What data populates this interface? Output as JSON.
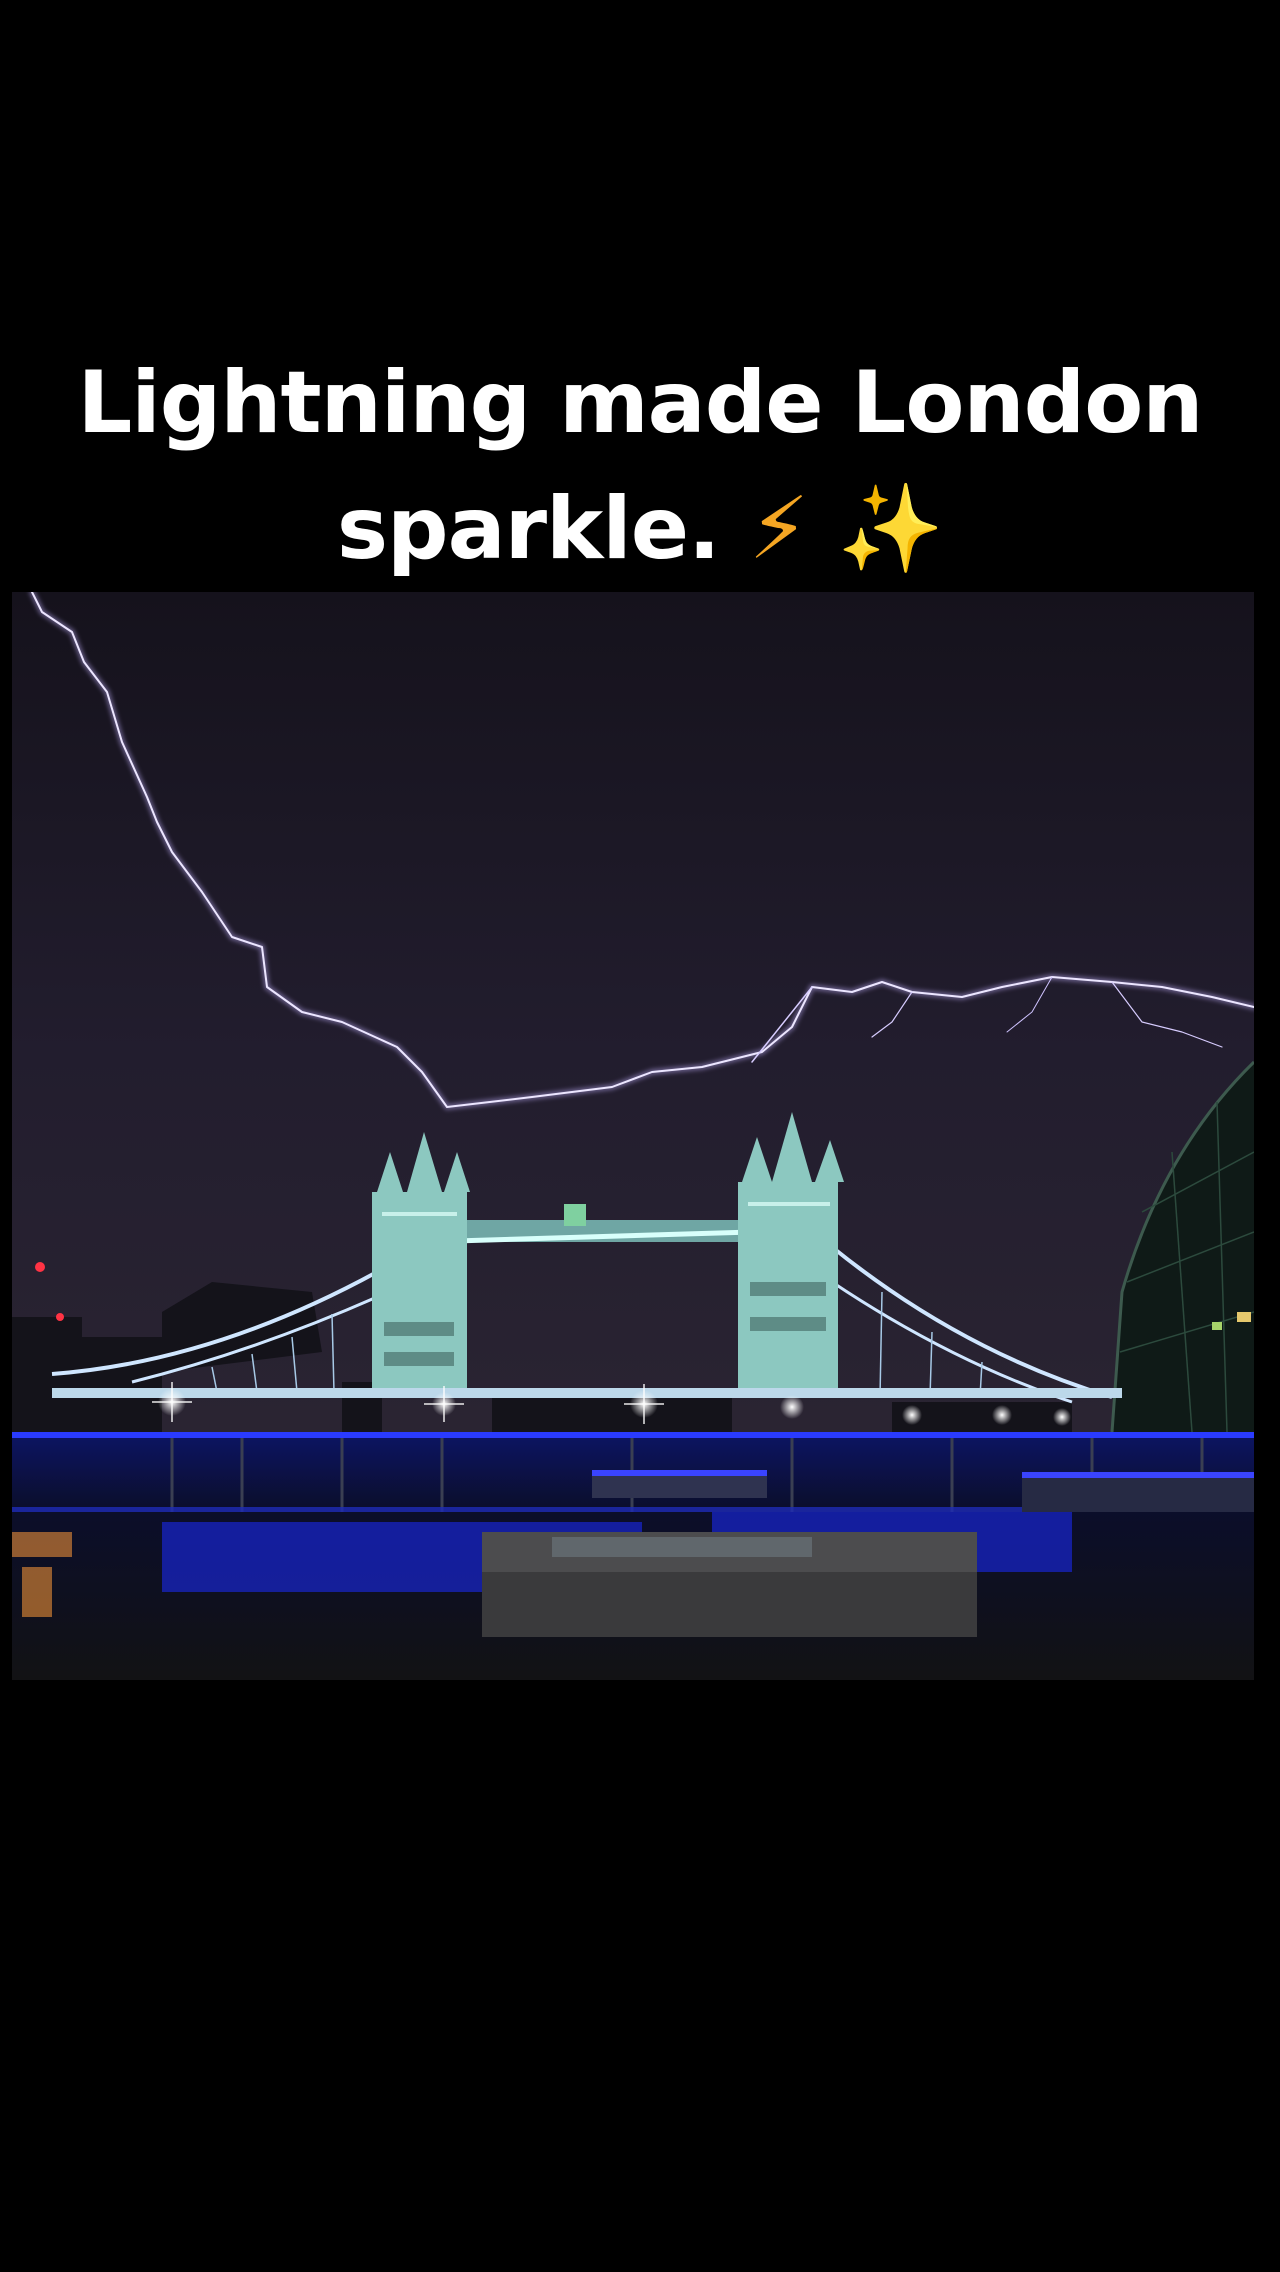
{
  "caption": {
    "line1": "Lightning made London",
    "line2": "sparkle.",
    "emoji_bolt": "⚡",
    "emoji_sparkles": "✨"
  },
  "photo": {
    "subject": "tower-bridge-lightning",
    "colors": {
      "sky": "#1b1826",
      "lightning": "#e6defc",
      "bridge": "#9fd7d0",
      "water_light": "#1a3bff",
      "ground": "#111114"
    }
  }
}
